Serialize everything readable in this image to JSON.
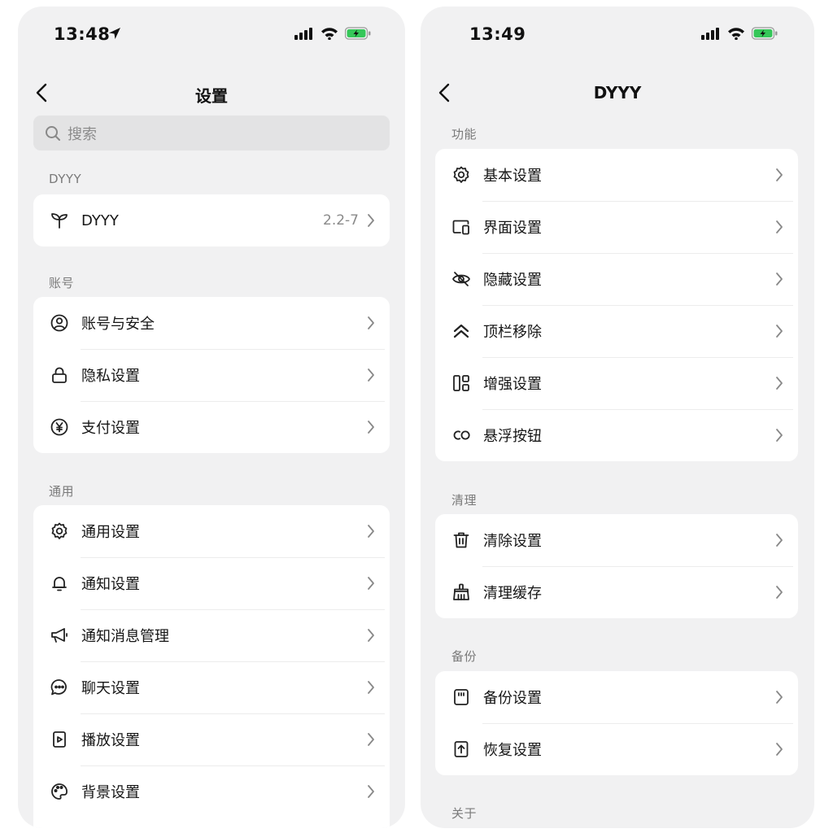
{
  "left_screen": {
    "status": {
      "time": "13:48"
    },
    "nav": {
      "title": "设置"
    },
    "search": {
      "placeholder": "搜索"
    },
    "sections": [
      {
        "title": "DYYY",
        "items": [
          {
            "icon": "sprout-icon",
            "label": "DYYY",
            "value": "2.2-7"
          }
        ]
      },
      {
        "title": "账号",
        "items": [
          {
            "icon": "user-circle-icon",
            "label": "账号与安全"
          },
          {
            "icon": "lock-icon",
            "label": "隐私设置"
          },
          {
            "icon": "yen-icon",
            "label": "支付设置"
          }
        ]
      },
      {
        "title": "通用",
        "items": [
          {
            "icon": "gear-icon",
            "label": "通用设置"
          },
          {
            "icon": "bell-icon",
            "label": "通知设置"
          },
          {
            "icon": "megaphone-icon",
            "label": "通知消息管理"
          },
          {
            "icon": "chat-bubble-icon",
            "label": "聊天设置"
          },
          {
            "icon": "play-icon",
            "label": "播放设置"
          },
          {
            "icon": "palette-icon",
            "label": "背景设置"
          }
        ]
      }
    ]
  },
  "right_screen": {
    "status": {
      "time": "13:49"
    },
    "nav": {
      "title": "DYYY"
    },
    "sections": [
      {
        "title": "功能",
        "items": [
          {
            "icon": "gear-icon",
            "label": "基本设置"
          },
          {
            "icon": "devices-icon",
            "label": "界面设置"
          },
          {
            "icon": "eye-off-icon",
            "label": "隐藏设置"
          },
          {
            "icon": "double-chevron-up-icon",
            "label": "顶栏移除"
          },
          {
            "icon": "layout-grid-icon",
            "label": "增强设置"
          },
          {
            "icon": "co-icon",
            "label": "悬浮按钮"
          }
        ]
      },
      {
        "title": "清理",
        "items": [
          {
            "icon": "trash-icon",
            "label": "清除设置"
          },
          {
            "icon": "broom-icon",
            "label": "清理缓存"
          }
        ]
      },
      {
        "title": "备份",
        "items": [
          {
            "icon": "sd-card-icon",
            "label": "备份设置"
          },
          {
            "icon": "upload-icon",
            "label": "恢复设置"
          }
        ]
      },
      {
        "title": "关于",
        "items": []
      }
    ]
  },
  "colors": {
    "background": "#f1f1f2",
    "card": "#ffffff",
    "battery": "#35c759",
    "secondary_text": "#8a8a8a"
  }
}
